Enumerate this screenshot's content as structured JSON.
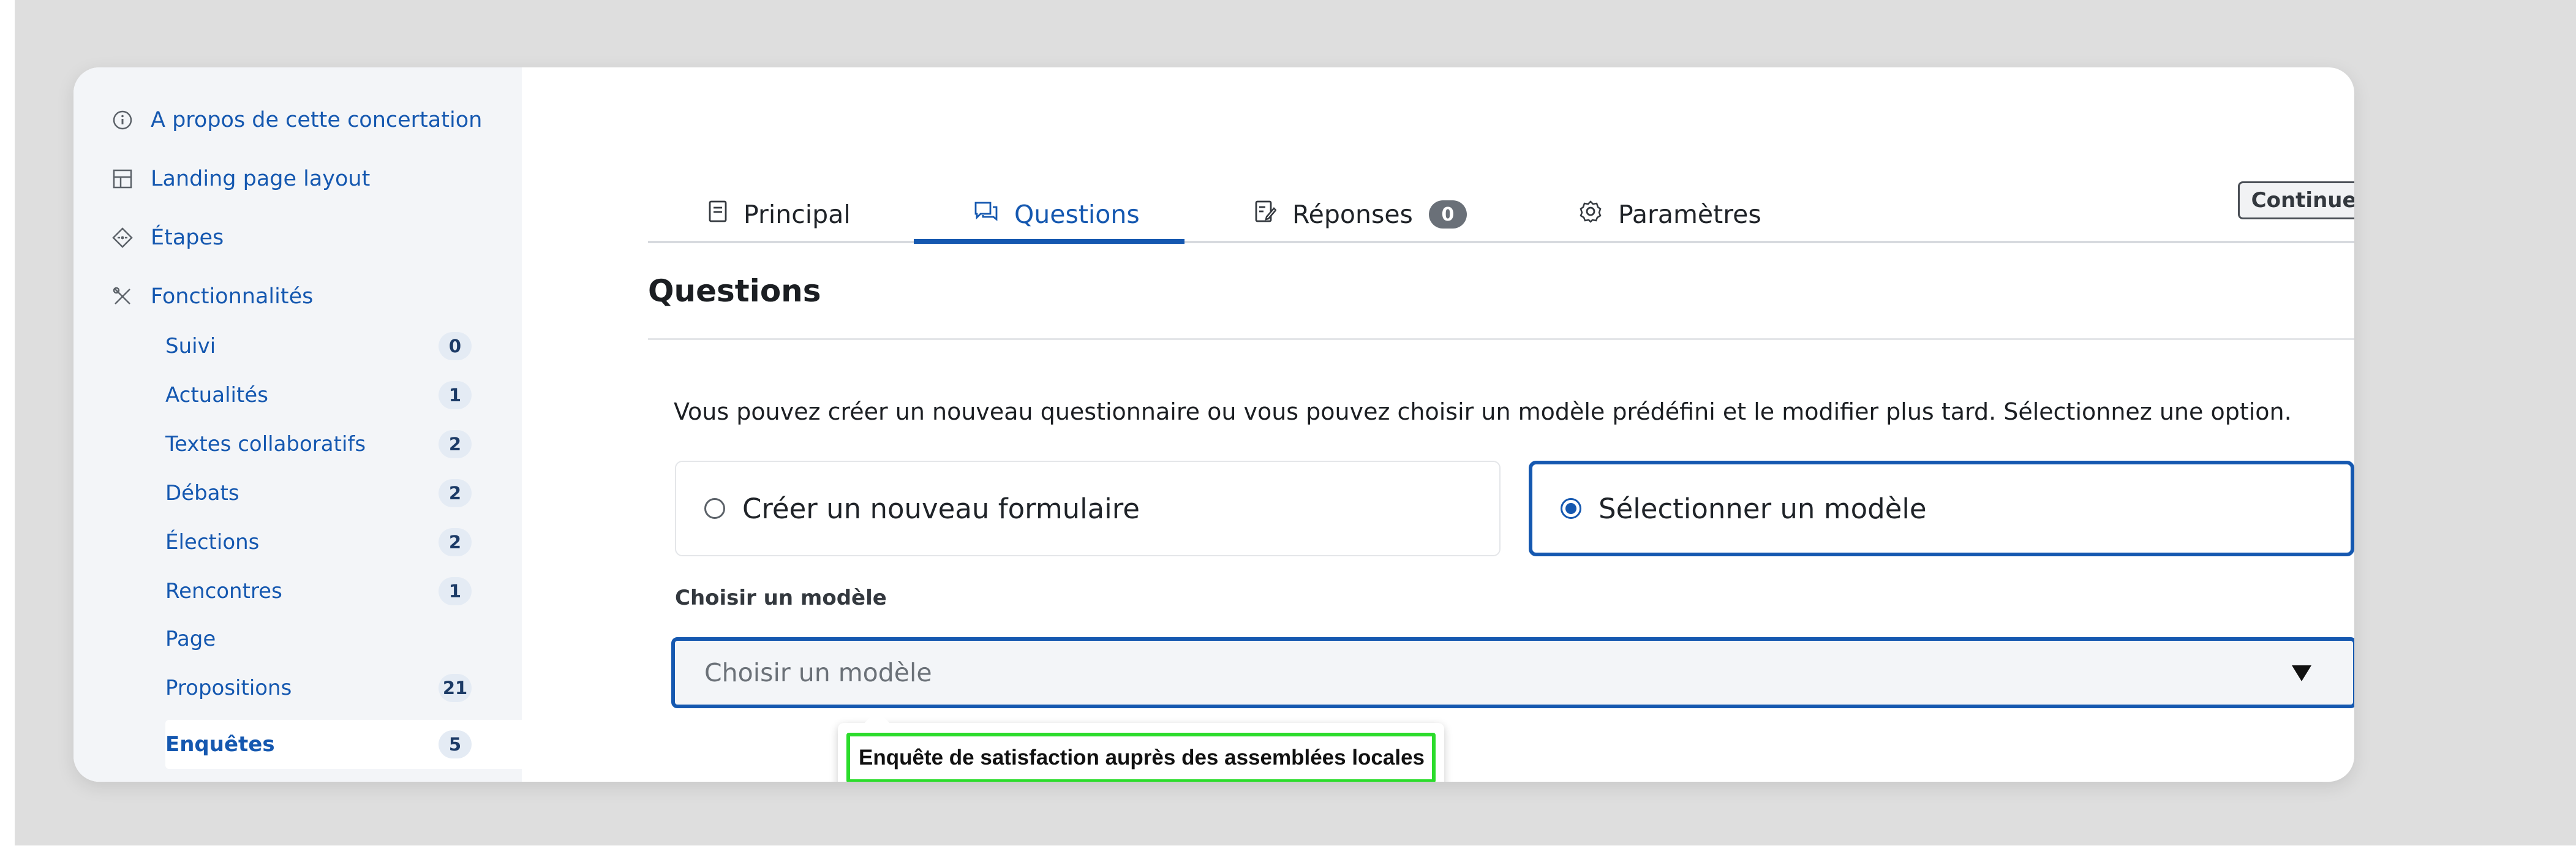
{
  "sidebar": {
    "items": [
      {
        "label": "A propos de cette concertation",
        "icon": "info-icon"
      },
      {
        "label": "Landing page layout",
        "icon": "layout-icon"
      },
      {
        "label": "Étapes",
        "icon": "steps-icon"
      },
      {
        "label": "Fonctionnalités",
        "icon": "tools-icon"
      }
    ],
    "sub_items": [
      {
        "label": "Suivi",
        "count": "0"
      },
      {
        "label": "Actualités",
        "count": "1"
      },
      {
        "label": "Textes collaboratifs",
        "count": "2"
      },
      {
        "label": "Débats",
        "count": "2"
      },
      {
        "label": "Élections",
        "count": "2"
      },
      {
        "label": "Rencontres",
        "count": "1"
      },
      {
        "label": "Page",
        "count": ""
      },
      {
        "label": "Propositions",
        "count": "21"
      },
      {
        "label": "Enquêtes",
        "count": "5",
        "active": true
      }
    ]
  },
  "tabs": [
    {
      "label": "Principal",
      "icon": "document-icon"
    },
    {
      "label": "Questions",
      "icon": "chat-icon",
      "active": true
    },
    {
      "label": "Réponses",
      "icon": "edit-icon",
      "badge": "0"
    },
    {
      "label": "Paramètres",
      "icon": "gear-icon"
    }
  ],
  "toolbar": {
    "continue_label": "Continuer"
  },
  "main": {
    "title": "Questions",
    "intro": "Vous pouvez créer un nouveau questionnaire ou vous pouvez choisir un modèle prédéfini et le modifier plus tard. Sélectionnez une option.",
    "options": [
      {
        "label": "Créer un nouveau formulaire",
        "selected": false
      },
      {
        "label": "Sélectionner un modèle",
        "selected": true
      }
    ],
    "template_field": {
      "label": "Choisir un modèle",
      "placeholder": "Choisir un modèle",
      "dropdown_option": "Enquête de satisfaction auprès des assemblées locales"
    }
  },
  "colors": {
    "accent": "#1558b0",
    "highlight": "#2bdc2b",
    "sidebar_bg": "#f3f5f8"
  }
}
